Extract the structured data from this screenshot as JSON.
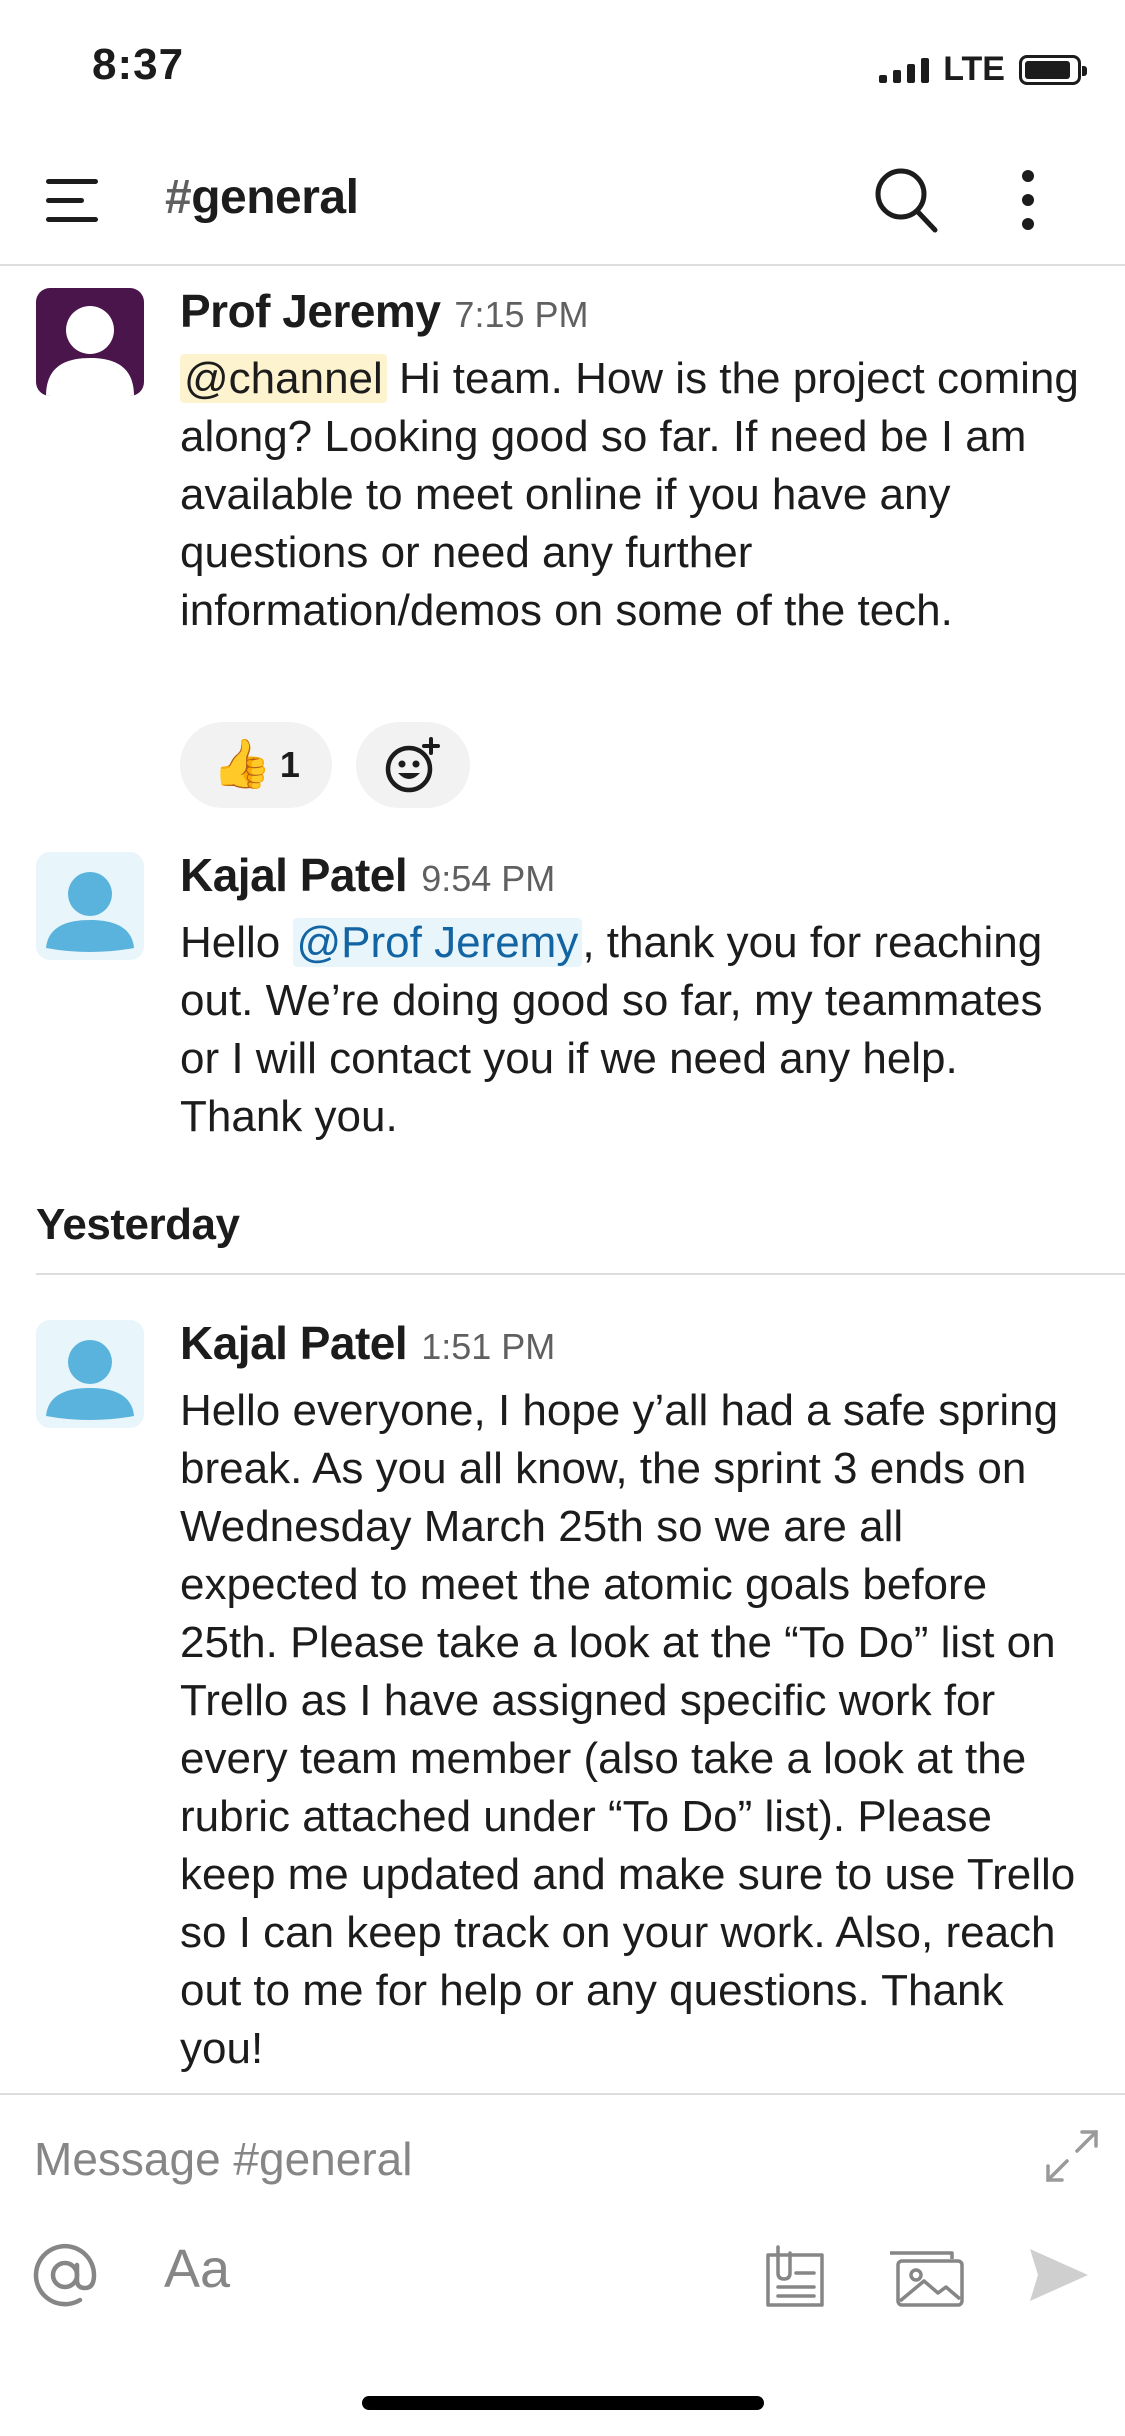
{
  "status_bar": {
    "time": "8:37",
    "network": "LTE"
  },
  "header": {
    "hash": "#",
    "channel": "general"
  },
  "messages": [
    {
      "sender": "Prof Jeremy",
      "time": "7:15 PM",
      "mention": "@channel",
      "text": " Hi team.  How is the project coming along?  Looking good so far.  If need be I am available to meet online if you have any questions or need any further information/demos on some of the tech.",
      "reactions": [
        {
          "emoji": "👍",
          "count": "1"
        }
      ]
    },
    {
      "sender": "Kajal Patel",
      "time": "9:54 PM",
      "text_before": "Hello ",
      "mention": "@Prof Jeremy",
      "text_after": ", thank you for reaching out. We’re doing good so far, my teammates or I will contact you if we need any help. Thank you."
    },
    {
      "sender": "Kajal Patel",
      "time": "1:51 PM",
      "text": "Hello everyone, I hope y’all had a safe spring break. As you all know, the sprint 3 ends on Wednesday March 25th so we are all expected to meet the atomic goals before 25th. Please take a look at the “To Do” list on Trello as I have assigned specific work for every team member (also take a look at the rubric attached under “To Do” list). Please keep me updated and make sure to use Trello so I can keep track on your work. Also, reach out to me for help or any questions. Thank you!"
    }
  ],
  "date_divider": "Yesterday",
  "composer": {
    "placeholder": "Message #general",
    "value": "",
    "format_label": "Aa"
  },
  "colors": {
    "prof_avatar_bg": "#4a154b",
    "user_avatar_bg": "#e8f5fa",
    "user_avatar_fg": "#5ab3dc",
    "mention_user": "#1264a3",
    "mention_channel_bg": "#fdf3cf"
  },
  "icons": [
    "menu-icon",
    "search-icon",
    "more-icon",
    "emoji-add-icon",
    "expand-icon",
    "mention-icon",
    "shortcut-icon",
    "photo-icon",
    "send-icon"
  ]
}
